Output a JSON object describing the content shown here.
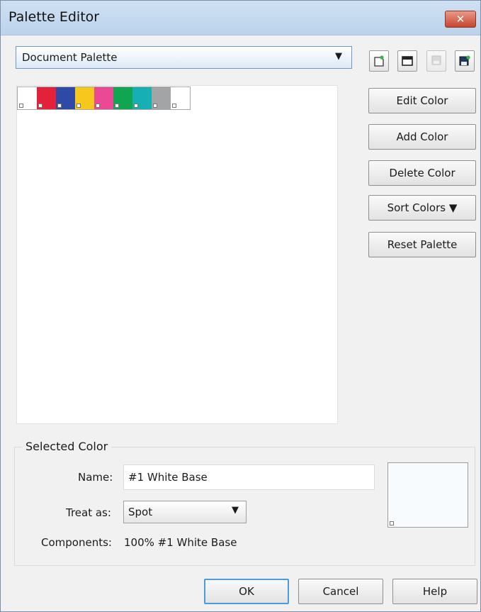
{
  "window": {
    "title": "Palette Editor",
    "close_label": "✕"
  },
  "palette_select": {
    "value": "Document Palette"
  },
  "toolbar": [
    "new-palette-icon",
    "open-palette-icon",
    "save-palette-icon",
    "save-as-palette-icon"
  ],
  "swatches": [
    {
      "name": "#1 White Base",
      "color": "#ffffff"
    },
    {
      "name": "Red",
      "color": "#e3213a"
    },
    {
      "name": "Blue",
      "color": "#2e4aa6"
    },
    {
      "name": "Yellow",
      "color": "#f6c81e"
    },
    {
      "name": "Pink",
      "color": "#eb4896"
    },
    {
      "name": "Green",
      "color": "#10a550"
    },
    {
      "name": "Teal",
      "color": "#16b0b4"
    },
    {
      "name": "Gray",
      "color": "#a2a4a6"
    },
    {
      "name": "White",
      "color": "#ffffff"
    }
  ],
  "side_buttons": {
    "edit_color": "Edit Color",
    "add_color": "Add Color",
    "delete_color": "Delete Color",
    "sort_colors": "Sort Colors ▼",
    "reset_palette": "Reset Palette"
  },
  "selected_color": {
    "group_title": "Selected Color",
    "name_label": "Name:",
    "name_value": "#1 White Base",
    "treat_as_label": "Treat as:",
    "treat_as_value": "Spot",
    "components_label": "Components:",
    "components_value": "100% #1 White Base",
    "preview_color": "#f8fbfd"
  },
  "footer": {
    "ok": "OK",
    "cancel": "Cancel",
    "help": "Help"
  }
}
